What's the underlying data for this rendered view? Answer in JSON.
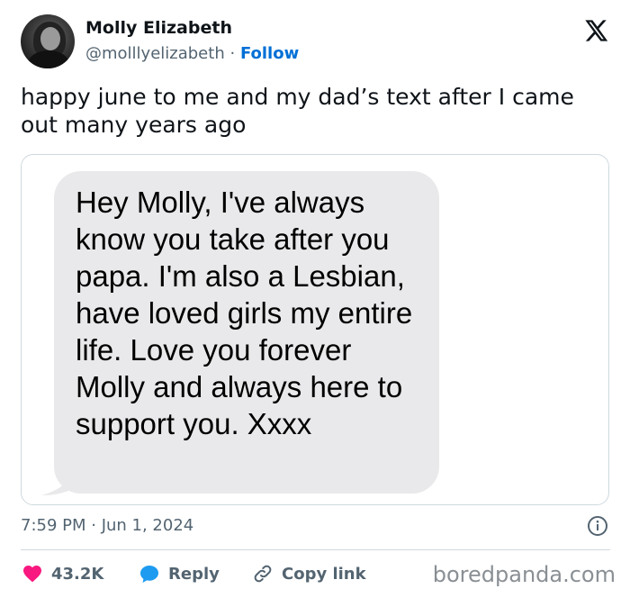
{
  "author": {
    "name": "Molly Elizabeth",
    "handle": "@molllyelizabeth",
    "separator": "·",
    "follow_label": "Follow"
  },
  "tweet": {
    "text": "happy june to me and my dad’s text after I came out many years ago",
    "timestamp": "7:59 PM · Jun 1, 2024"
  },
  "message": {
    "text": "Hey Molly, I've always know you take after you papa. I'm also a Lesbian, have loved girls my entire life. Love you forever Molly and always here to support you. Xxxx"
  },
  "actions": {
    "likes": "43.2K",
    "reply_label": "Reply",
    "copy_link_label": "Copy link"
  },
  "watermark": "boredpanda.com",
  "colors": {
    "like": "#f91880",
    "link": "#006fd6",
    "muted": "#536471",
    "bubble": "#e9e9eb"
  },
  "icons": [
    "x-logo-icon",
    "info-icon",
    "heart-icon",
    "reply-bubble-icon",
    "link-icon"
  ]
}
